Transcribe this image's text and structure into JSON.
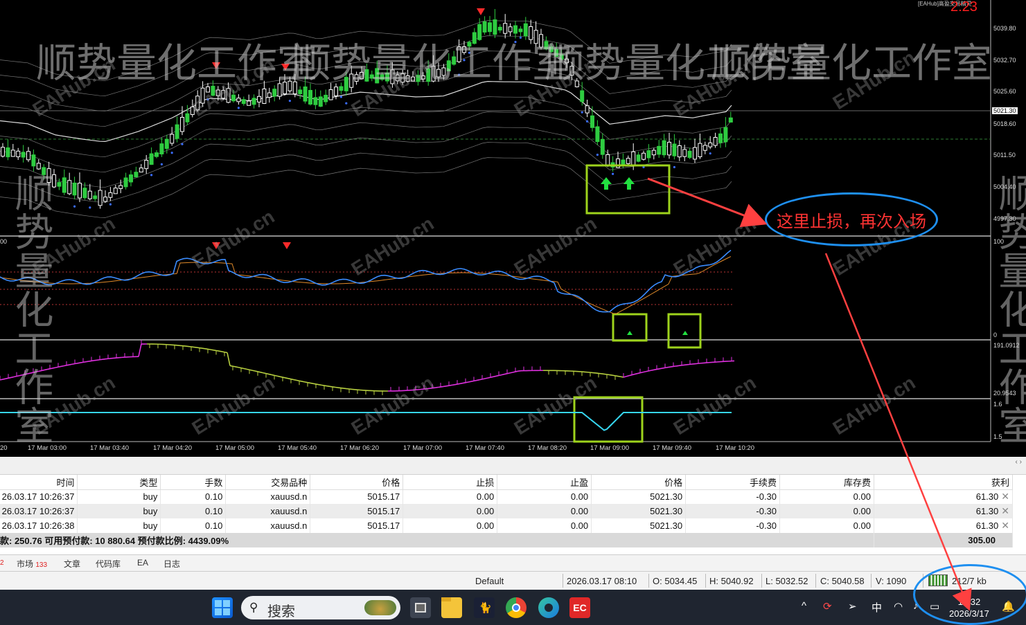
{
  "chart": {
    "top_right_label": "[EAHub]高盈交易精灵",
    "timer": "2:23",
    "price_axis": [
      "5039.80",
      "5032.70",
      "5025.60",
      "5021.30",
      "5018.60",
      "5011.50",
      "5004.40",
      "4997.30"
    ],
    "current_price": "5021.30",
    "indicator1_axis": [
      "100",
      "0"
    ],
    "indicator1_left": "00",
    "indicator2_axis": [
      "191.0912",
      "20.9543"
    ],
    "indicator3_axis": [
      "1.6",
      "1.5"
    ],
    "time_axis": [
      "17 Mar 03:00",
      "17 Mar 03:40",
      "17 Mar 04:20",
      "17 Mar 05:00",
      "17 Mar 05:40",
      "17 Mar 06:20",
      "17 Mar 07:00",
      "17 Mar 07:40",
      "17 Mar 08:20",
      "17 Mar 09:00",
      "17 Mar 09:40",
      "17 Mar 10:20"
    ],
    "time_axis_left": "20",
    "watermark_big": "顺势量化工作室",
    "watermark_small": "EAHub.cn",
    "callout_text": "这里止损，再次入场",
    "colors": {
      "bull": "#ffffff",
      "bear": "#2ecc40",
      "highlight_box": "#9ed31c",
      "callout": "#1e8ff0",
      "arrow": "#ff4040"
    }
  },
  "trade_table": {
    "headers": [
      "时间",
      "类型",
      "手数",
      "交易品种",
      "价格",
      "止损",
      "止盈",
      "价格",
      "手续费",
      "库存费",
      "获利"
    ],
    "rows": [
      [
        "26.03.17 10:26:37",
        "buy",
        "0.10",
        "xauusd.n",
        "5015.17",
        "0.00",
        "0.00",
        "5021.30",
        "-0.30",
        "0.00",
        "61.30"
      ],
      [
        "26.03.17 10:26:37",
        "buy",
        "0.10",
        "xauusd.n",
        "5015.17",
        "0.00",
        "0.00",
        "5021.30",
        "-0.30",
        "0.00",
        "61.30"
      ],
      [
        "26.03.17 10:26:38",
        "buy",
        "0.10",
        "xauusd.n",
        "5015.17",
        "0.00",
        "0.00",
        "5021.30",
        "-0.30",
        "0.00",
        "61.30"
      ]
    ],
    "summary_text": "款: 250.76  可用预付款: 10 880.64  预付款比例: 4439.09%",
    "summary_total": "305.00"
  },
  "tabs": {
    "prefix": "2",
    "items": [
      {
        "label": "市场",
        "badge": "133"
      },
      {
        "label": "文章",
        "badge": ""
      },
      {
        "label": "代码库",
        "badge": ""
      },
      {
        "label": "EA",
        "badge": ""
      },
      {
        "label": "日志",
        "badge": ""
      }
    ]
  },
  "status_bar": {
    "profile": "Default",
    "datetime": "2026.03.17 08:10",
    "open": "O: 5034.45",
    "high": "H: 5040.92",
    "low": "L: 5032.52",
    "close": "C: 5040.58",
    "volume": "V: 1090",
    "traffic": "212/7 kb"
  },
  "taskbar": {
    "search_placeholder": "搜索",
    "ime": "中",
    "time": "15:32",
    "date": "2026/3/17",
    "icons": [
      "windows-start-icon",
      "task-view-icon",
      "file-explorer-icon",
      "cat-app-icon",
      "chrome-icon",
      "edge-icon",
      "ec-app-icon"
    ]
  }
}
